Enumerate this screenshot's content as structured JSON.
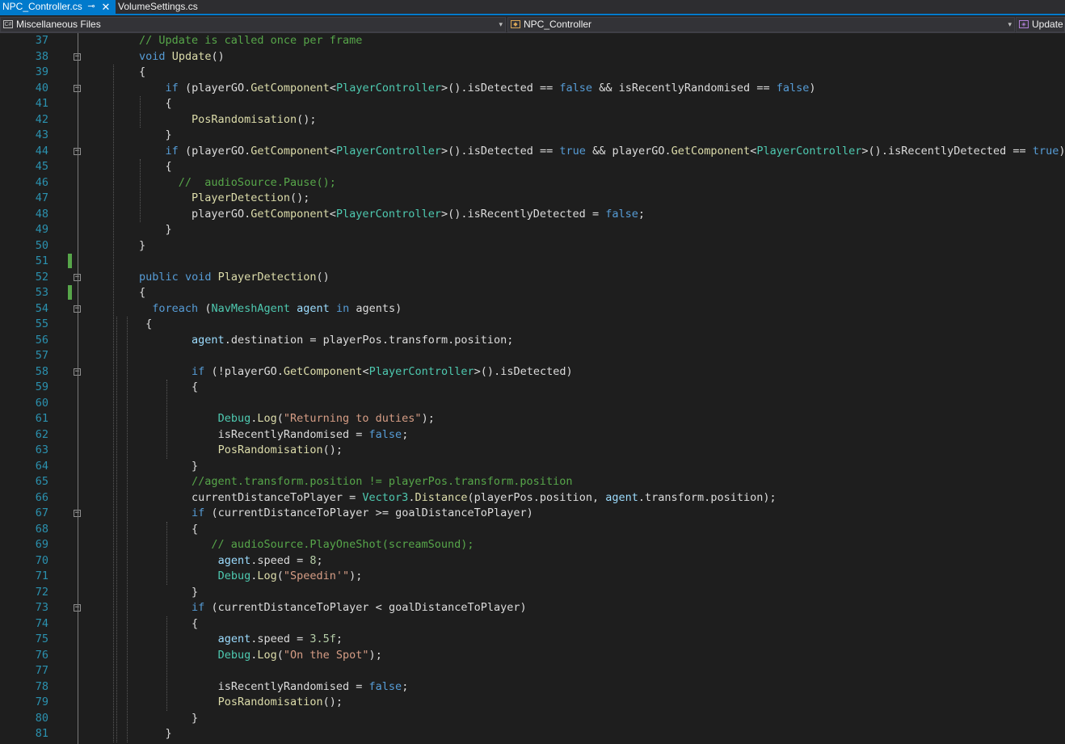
{
  "tabs": [
    {
      "label": "NPC_Controller.cs",
      "active": true,
      "pin_icon": "pin-icon",
      "close_icon": "close-icon"
    },
    {
      "label": "VolumeSettings.cs",
      "active": false
    }
  ],
  "navbar": {
    "project": {
      "icon": "csharp-file-icon",
      "label": "Miscellaneous Files"
    },
    "type": {
      "icon": "class-icon",
      "label": "NPC_Controller"
    },
    "member": {
      "icon": "method-icon",
      "label": "Update"
    }
  },
  "colors": {
    "keyword": "#569cd6",
    "comment": "#57a64a",
    "string": "#d69d85",
    "method": "#dcdcaa",
    "type": "#4ec9b0",
    "variable": "#9cdcfe",
    "number": "#b5cea8",
    "line_number": "#2b91af",
    "accent": "#007acc"
  },
  "editor": {
    "line_numbers": [
      "37",
      "38",
      "39",
      "40",
      "41",
      "42",
      "43",
      "44",
      "45",
      "46",
      "47",
      "48",
      "49",
      "50",
      "51",
      "52",
      "53",
      "54",
      "55",
      "56",
      "57",
      "58",
      "59",
      "60",
      "61",
      "62",
      "63",
      "64",
      "65",
      "66",
      "67",
      "68",
      "69",
      "70",
      "71",
      "72",
      "73",
      "74",
      "75",
      "76",
      "77",
      "78",
      "79",
      "80",
      "81"
    ],
    "lines": [
      "        // Update is called once per frame",
      "        void Update()",
      "        {",
      "            if (playerGO.GetComponent<PlayerController>().isDetected == false && isRecentlyRandomised == false)",
      "            {",
      "                PosRandomisation();",
      "            }",
      "            if (playerGO.GetComponent<PlayerController>().isDetected == true && playerGO.GetComponent<PlayerController>().isRecentlyDetected == true)",
      "            {",
      "              //  audioSource.Pause();",
      "                PlayerDetection();",
      "                playerGO.GetComponent<PlayerController>().isRecentlyDetected = false;",
      "            }",
      "        }",
      "",
      "        public void PlayerDetection()",
      "        {",
      "          foreach (NavMeshAgent agent in agents)",
      "         {",
      "                agent.destination = playerPos.transform.position;",
      "",
      "                if (!playerGO.GetComponent<PlayerController>().isDetected)",
      "                {",
      "",
      "                    Debug.Log(\"Returning to duties\");",
      "                    isRecentlyRandomised = false;",
      "                    PosRandomisation();",
      "                }",
      "                //agent.transform.position != playerPos.transform.position",
      "                currentDistanceToPlayer = Vector3.Distance(playerPos.position, agent.transform.position);",
      "                if (currentDistanceToPlayer >= goalDistanceToPlayer)",
      "                {",
      "                   // audioSource.PlayOneShot(screamSound);",
      "                    agent.speed = 8;",
      "                    Debug.Log(\"Speedin'\");",
      "                }",
      "                if (currentDistanceToPlayer < goalDistanceToPlayer)",
      "                {",
      "                    agent.speed = 3.5f;",
      "                    Debug.Log(\"On the Spot\");",
      "",
      "                    isRecentlyRandomised = false;",
      "                    PosRandomisation();",
      "                }",
      "            }"
    ]
  }
}
